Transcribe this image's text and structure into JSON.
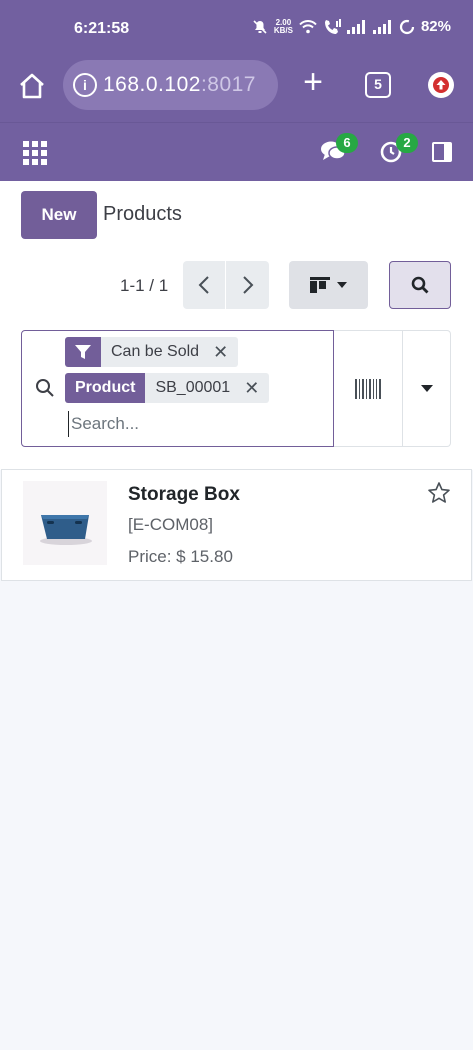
{
  "statusbar": {
    "time": "6:21:58",
    "speed_value": "2.00",
    "speed_unit": "KB/S",
    "battery": "82%"
  },
  "browser": {
    "url_host": "168.0.102",
    "url_port": ":8017",
    "tab_count": "5",
    "info_glyph": "i"
  },
  "nav": {
    "messages_badge": "6",
    "activities_badge": "2"
  },
  "control": {
    "new_label": "New",
    "title": "Products",
    "pager_value": "1-1 / 1"
  },
  "search": {
    "facets": [
      {
        "label": "",
        "label_icon": "filter-icon",
        "value": "Can be Sold"
      },
      {
        "label": "Product",
        "value": "SB_00001"
      }
    ],
    "placeholder": "Search...",
    "remove_glyph": "✕"
  },
  "products": [
    {
      "name": "Storage Box",
      "ref": "[E-COM08]",
      "price": "Price: $ 15.80"
    }
  ],
  "colors": {
    "brand": "#7260a0",
    "primary": "#725e99",
    "badge": "#27a844"
  }
}
